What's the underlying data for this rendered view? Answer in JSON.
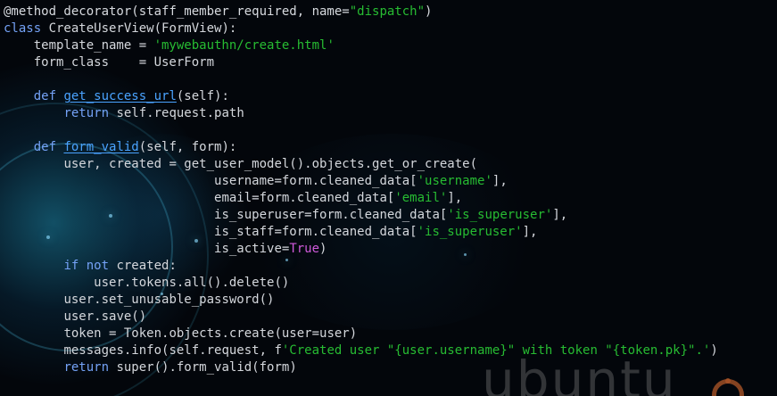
{
  "code": {
    "lines": [
      {
        "indent": "",
        "parts": [
          {
            "text": "@method_decorator(staff_member_required, name=",
            "kind": "decorator"
          },
          {
            "text": "\"dispatch\"",
            "kind": "str"
          },
          {
            "text": ")",
            "kind": "decorator"
          }
        ]
      },
      {
        "indent": "",
        "parts": [
          {
            "text": "class ",
            "kind": "kw"
          },
          {
            "text": "CreateUserView(FormView):",
            "kind": "plain"
          }
        ]
      },
      {
        "indent": "    ",
        "parts": [
          {
            "text": "template_name = ",
            "kind": "plain"
          },
          {
            "text": "'mywebauthn/create.html'",
            "kind": "str"
          }
        ]
      },
      {
        "indent": "    ",
        "parts": [
          {
            "text": "form_class    = UserForm",
            "kind": "plain"
          }
        ]
      },
      {
        "indent": "",
        "parts": []
      },
      {
        "indent": "    ",
        "parts": [
          {
            "text": "def ",
            "kind": "kw"
          },
          {
            "text": "get_success_url",
            "kind": "fn"
          },
          {
            "text": "(self):",
            "kind": "plain"
          }
        ]
      },
      {
        "indent": "        ",
        "parts": [
          {
            "text": "return ",
            "kind": "kw"
          },
          {
            "text": "self.request.path",
            "kind": "plain"
          }
        ]
      },
      {
        "indent": "",
        "parts": []
      },
      {
        "indent": "    ",
        "parts": [
          {
            "text": "def ",
            "kind": "kw"
          },
          {
            "text": "form_valid",
            "kind": "fn"
          },
          {
            "text": "(self, form):",
            "kind": "plain"
          }
        ]
      },
      {
        "indent": "        ",
        "parts": [
          {
            "text": "user, created = get_user_model().objects.get_or_create(",
            "kind": "plain"
          }
        ]
      },
      {
        "indent": "                            ",
        "parts": [
          {
            "text": "username=form.cleaned_data[",
            "kind": "plain"
          },
          {
            "text": "'username'",
            "kind": "str"
          },
          {
            "text": "],",
            "kind": "plain"
          }
        ]
      },
      {
        "indent": "                            ",
        "parts": [
          {
            "text": "email=form.cleaned_data[",
            "kind": "plain"
          },
          {
            "text": "'email'",
            "kind": "str"
          },
          {
            "text": "],",
            "kind": "plain"
          }
        ]
      },
      {
        "indent": "                            ",
        "parts": [
          {
            "text": "is_superuser=form.cleaned_data[",
            "kind": "plain"
          },
          {
            "text": "'is_superuser'",
            "kind": "str"
          },
          {
            "text": "],",
            "kind": "plain"
          }
        ]
      },
      {
        "indent": "                            ",
        "parts": [
          {
            "text": "is_staff=form.cleaned_data[",
            "kind": "plain"
          },
          {
            "text": "'is_superuser'",
            "kind": "str"
          },
          {
            "text": "],",
            "kind": "plain"
          }
        ]
      },
      {
        "indent": "                            ",
        "parts": [
          {
            "text": "is_active=",
            "kind": "plain"
          },
          {
            "text": "True",
            "kind": "true"
          },
          {
            "text": ")",
            "kind": "plain"
          }
        ]
      },
      {
        "indent": "        ",
        "parts": [
          {
            "text": "if ",
            "kind": "kw"
          },
          {
            "text": "not ",
            "kind": "kw"
          },
          {
            "text": "created:",
            "kind": "plain"
          }
        ]
      },
      {
        "indent": "            ",
        "parts": [
          {
            "text": "user.tokens.all().delete()",
            "kind": "plain"
          }
        ]
      },
      {
        "indent": "        ",
        "parts": [
          {
            "text": "user.set_unusable_password()",
            "kind": "plain"
          }
        ]
      },
      {
        "indent": "        ",
        "parts": [
          {
            "text": "user.save()",
            "kind": "plain"
          }
        ]
      },
      {
        "indent": "        ",
        "parts": [
          {
            "text": "token = Token.objects.create(user=user)",
            "kind": "plain"
          }
        ]
      },
      {
        "indent": "        ",
        "parts": [
          {
            "text": "messages.info(self.request, f",
            "kind": "plain"
          },
          {
            "text": "'Created user \"{user.username}\" with token \"{token.pk}\".'",
            "kind": "str"
          },
          {
            "text": ")",
            "kind": "plain"
          }
        ]
      },
      {
        "indent": "        ",
        "parts": [
          {
            "text": "return ",
            "kind": "kw"
          },
          {
            "text": "super().form_valid(form)",
            "kind": "plain"
          }
        ]
      }
    ]
  },
  "background": {
    "brand_word": "ubuntu",
    "logo_icon": "ubuntu-circle-icon"
  },
  "colors": {
    "background": "#03060b",
    "text": "#d4d7dc",
    "keyword": "#74a2f6",
    "string": "#27bc32",
    "function_name": "#4aa3ff",
    "boolean": "#d05adb"
  }
}
